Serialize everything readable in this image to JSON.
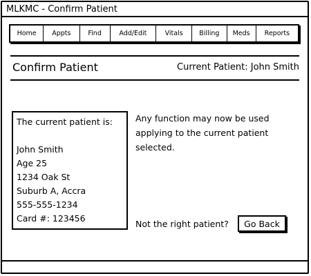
{
  "window": {
    "title": "MLKMC - Confirm Patient"
  },
  "nav": {
    "tabs": [
      {
        "label": "Home"
      },
      {
        "label": "Appts"
      },
      {
        "label": "Find"
      },
      {
        "label": "Add/Edit"
      },
      {
        "label": "Vitals"
      },
      {
        "label": "Billing"
      },
      {
        "label": "Meds"
      },
      {
        "label": "Reports"
      }
    ]
  },
  "header": {
    "title": "Confirm Patient",
    "current_patient": "Current Patient: John Smith"
  },
  "patient_card": {
    "heading": "The current patient is:",
    "name": "John Smith",
    "age": "Age 25",
    "street": "1234 Oak St",
    "city": "Suburb A, Accra",
    "phone": "555-555-1234",
    "card": "Card #: 123456"
  },
  "info": {
    "line1": "Any function may now be used",
    "line2": "applying to the current patient",
    "line3": "selected."
  },
  "footer": {
    "prompt": "Not the right patient?",
    "go_back_label": "Go Back"
  }
}
